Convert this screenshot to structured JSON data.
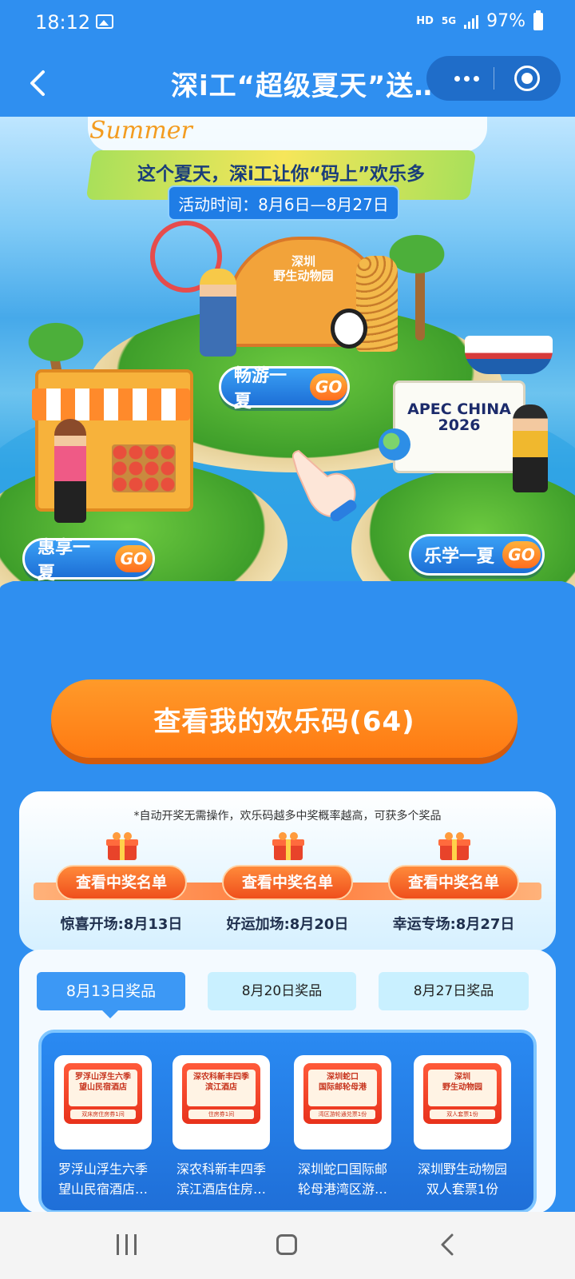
{
  "status_bar": {
    "time": "18:12",
    "hd": "HD",
    "network": "5G",
    "battery": "97%",
    "icons": [
      "image-icon",
      "signal-icon",
      "battery-icon"
    ]
  },
  "nav": {
    "title": "深i工“超级夏天”送…",
    "icons": [
      "back-icon",
      "more-icon",
      "close-icon"
    ]
  },
  "hero": {
    "summer_script": "Summer",
    "slogan": "这个夏天，深i工让你“码上”欢乐多",
    "activity_time": "活动时间：8月6日—8月27日",
    "zoo_sign": "深圳\n野生动物园",
    "apec_label": "APEC CHINA\n2026",
    "sections": [
      {
        "label": "畅游一夏",
        "go": "GO"
      },
      {
        "label": "惠享一夏",
        "go": "GO"
      },
      {
        "label": "乐学一夏",
        "go": "GO"
      }
    ]
  },
  "main_button": {
    "label": "查看我的欢乐码(64)"
  },
  "draw_info": {
    "note": "*自动开奖无需操作，欢乐码越多中奖概率越高，可获多个奖品",
    "rounds": [
      {
        "button": "查看中奖名单",
        "date": "惊喜开场:8月13日"
      },
      {
        "button": "查看中奖名单",
        "date": "好运加场:8月20日"
      },
      {
        "button": "查看中奖名单",
        "date": "幸运专场:8月27日"
      }
    ]
  },
  "prize_tabs": [
    {
      "label": "8月13日奖品",
      "active": true
    },
    {
      "label": "8月20日奖品",
      "active": false
    },
    {
      "label": "8月27日奖品",
      "active": false
    }
  ],
  "prizes": [
    {
      "ticket_title": "罗浮山浮生六季\n望山民宿酒店",
      "ticket_sub": "双床房住房券1间",
      "name": "罗浮山浮生六季\n望山民宿酒店…"
    },
    {
      "ticket_title": "深农科新丰四季\n滨江酒店",
      "ticket_sub": "住房券1间",
      "name": "深农科新丰四季\n滨江酒店住房…"
    },
    {
      "ticket_title": "深圳蛇口\n国际邮轮母港",
      "ticket_sub": "湾区游轮通兑票1份",
      "name": "深圳蛇口国际邮\n轮母港湾区游…"
    },
    {
      "ticket_title": "深圳\n野生动物园",
      "ticket_sub": "双人套票1份",
      "name": "深圳野生动物园\n双人套票1份"
    }
  ],
  "system_nav": {
    "icons": [
      "recents-icon",
      "home-icon",
      "back-icon"
    ]
  }
}
